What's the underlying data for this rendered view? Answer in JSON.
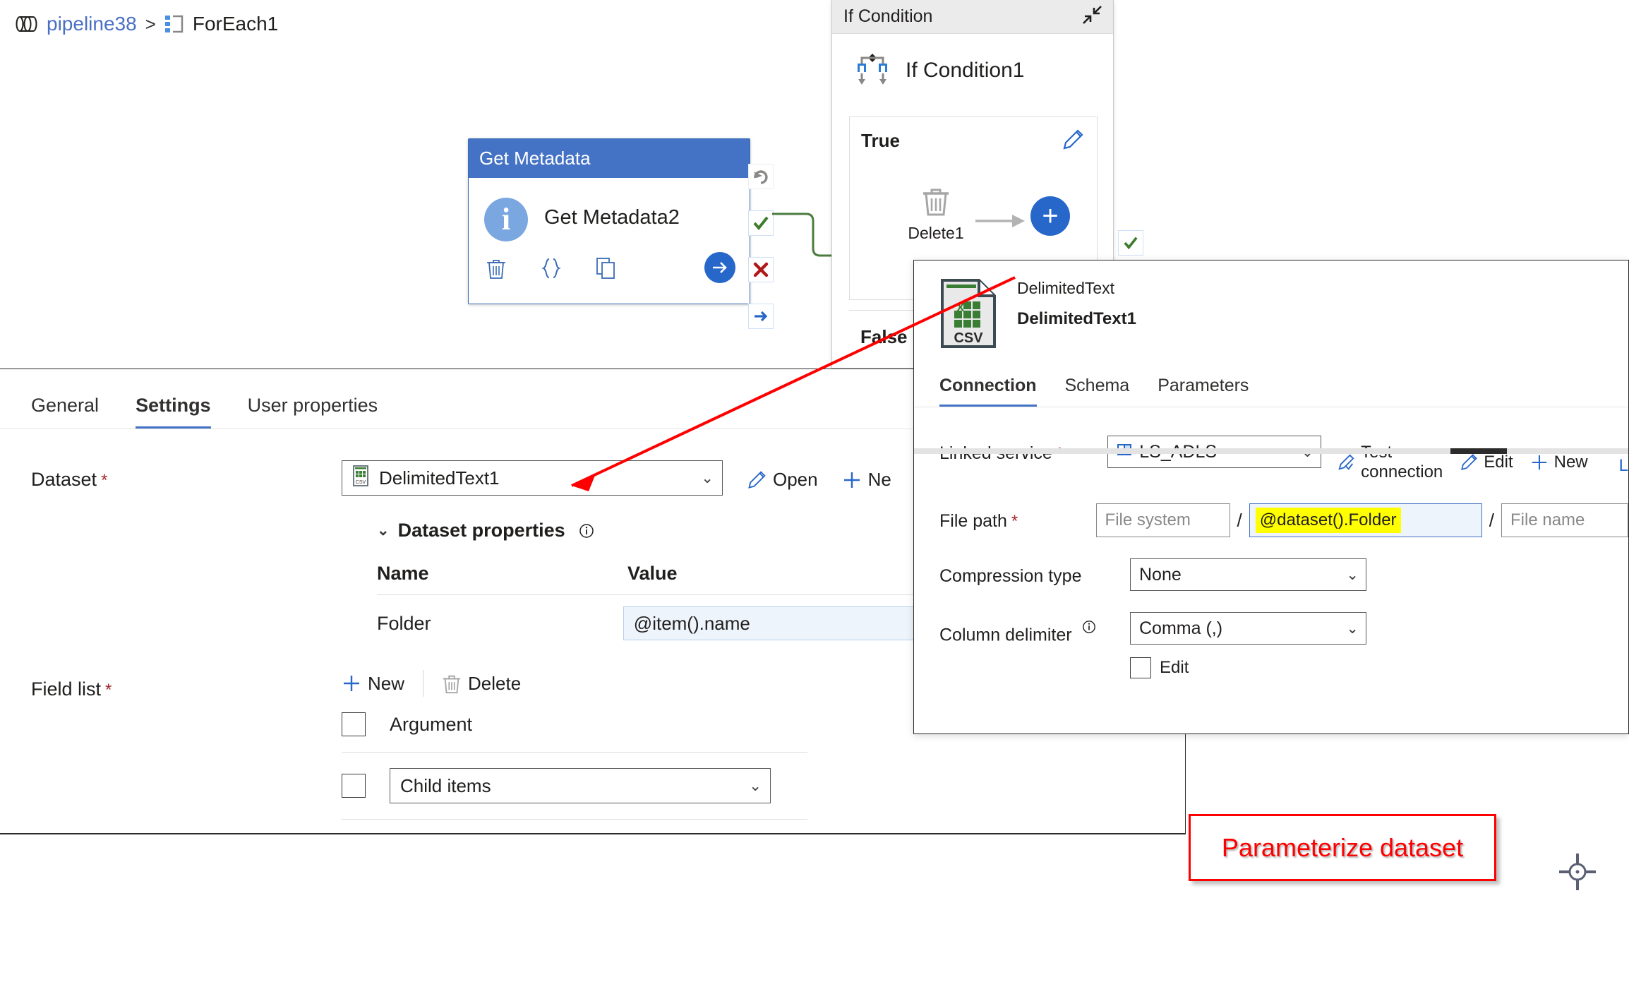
{
  "breadcrumb": {
    "pipeline_icon": "pipeline-icon",
    "pipeline": "pipeline38",
    "separator": ">",
    "activity_icon": "foreach-icon",
    "activity": "ForEach1"
  },
  "canvas": {
    "get_metadata_card": {
      "header": "Get Metadata",
      "name": "Get Metadata2",
      "avatar_glyph": "i",
      "actions": [
        "delete-icon",
        "code-braces-icon",
        "clone-icon"
      ],
      "run_icon": "arrow-right-icon",
      "handles": [
        "retry-icon",
        "success-check-icon",
        "failure-x-icon",
        "completion-arrow-icon"
      ],
      "header_color": "#4472c4",
      "success_color": "#4a7c3f"
    },
    "if_condition_panel": {
      "header": "If Condition",
      "collapse_icon": "collapse-icon",
      "title": "If Condition1",
      "title_icon": "if-condition-icon",
      "true_label": "True",
      "edit_icon": "pencil-icon",
      "activity": {
        "name": "Delete1",
        "icon": "trash-icon"
      },
      "add_icon": "plus-icon",
      "false_label": "False",
      "ok_handle": "success-check-icon"
    }
  },
  "properties_panel": {
    "tabs": [
      {
        "label": "General",
        "active": false
      },
      {
        "label": "Settings",
        "active": true
      },
      {
        "label": "User properties",
        "active": false
      }
    ],
    "dataset": {
      "label": "Dataset",
      "required": "*",
      "value": "DelimitedText1",
      "value_icon": "csv-file-icon",
      "chevron": "⌄",
      "actions": [
        {
          "label": "Open",
          "icon": "pencil-icon"
        },
        {
          "label": "Ne",
          "icon": "plus-icon"
        }
      ]
    },
    "dataset_properties": {
      "title": "Dataset properties",
      "chevron": "⌄",
      "info_icon": "info-icon",
      "columns": [
        "Name",
        "Value"
      ],
      "rows": [
        {
          "name": "Folder",
          "value": "@item().name"
        }
      ]
    },
    "field_list": {
      "label": "Field list",
      "required": "*",
      "toolbar": [
        {
          "label": "New",
          "icon": "plus-icon"
        },
        {
          "label": "Delete",
          "icon": "trash-icon"
        }
      ],
      "header_row": {
        "label": "Argument",
        "checked": false
      },
      "rows": [
        {
          "value": "Child items",
          "checked": false,
          "chevron": "⌄"
        }
      ]
    }
  },
  "dataset_panel": {
    "type": "DelimitedText",
    "name": "DelimitedText1",
    "icon": "csv-file-icon",
    "tabs": [
      {
        "label": "Connection",
        "active": true
      },
      {
        "label": "Schema",
        "active": false
      },
      {
        "label": "Parameters",
        "active": false
      }
    ],
    "linked_service": {
      "label": "Linked service",
      "required": "*",
      "value": "LS_ADLS",
      "value_icon": "linked-service-icon",
      "chevron": "⌄",
      "actions": [
        {
          "label": "Test connection",
          "icon": "test-connection-icon"
        },
        {
          "label": "Edit",
          "icon": "pencil-icon"
        },
        {
          "label": "New",
          "icon": "plus-icon"
        }
      ],
      "more": "L"
    },
    "file_path": {
      "label": "File path",
      "required": "*",
      "file_system_placeholder": "File system",
      "folder_value": "@dataset().Folder",
      "folder_highlight_color": "#ffff00",
      "file_name_placeholder": "File name",
      "separator": "/"
    },
    "compression_type": {
      "label": "Compression type",
      "value": "None",
      "chevron": "⌄"
    },
    "column_delimiter": {
      "label": "Column delimiter",
      "info_icon": "info-icon",
      "value": "Comma (,)",
      "chevron": "⌄",
      "edit_checkbox": {
        "label": "Edit",
        "checked": false
      }
    }
  },
  "annotations": {
    "callout": {
      "text": "Parameterize dataset",
      "color": "#ff0000"
    },
    "arrow": {
      "color": "#ff0000",
      "name": "red-pointer-arrow"
    },
    "cursor": "crosshair-move-icon"
  }
}
